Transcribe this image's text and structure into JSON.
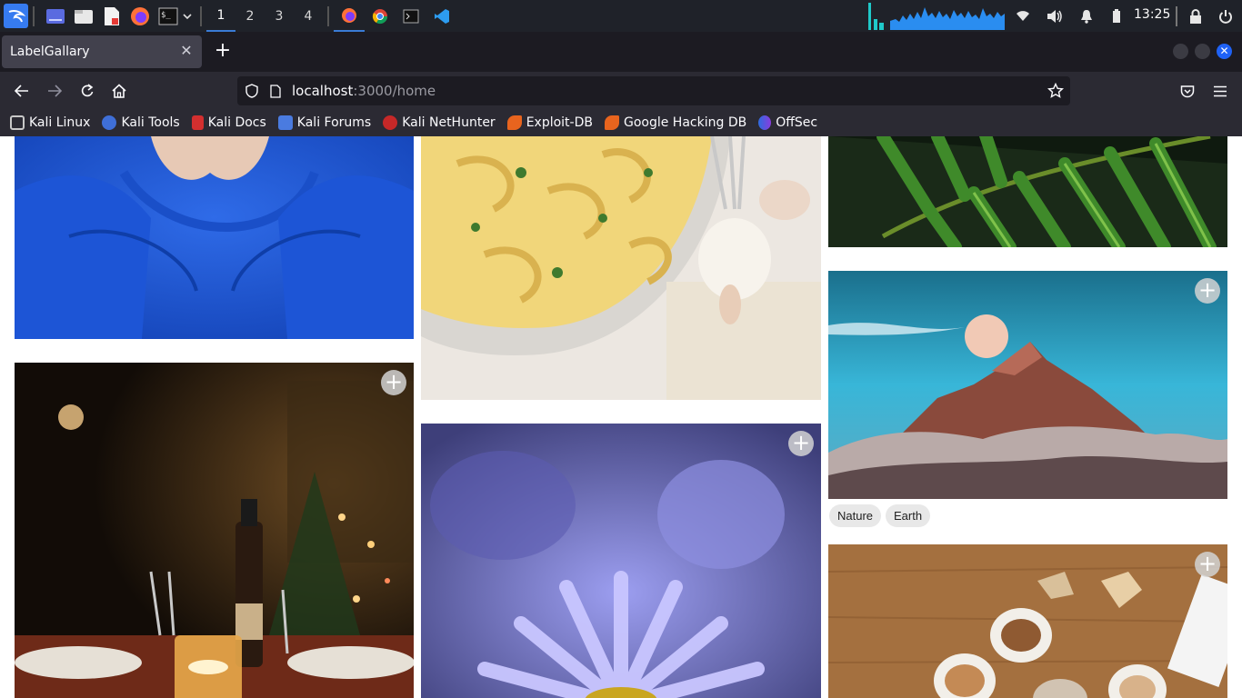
{
  "taskbar": {
    "workspaces": [
      "1",
      "2",
      "3",
      "4"
    ],
    "active_workspace": "1",
    "clock": "13:25",
    "icons": [
      "kali-menu-icon",
      "workspace-desktop-icon",
      "file-manager-icon",
      "text-editor-icon",
      "firefox-icon",
      "terminal-icon",
      "chevron-down-icon",
      "firefox-window-icon",
      "chrome-window-icon",
      "terminal-window-icon",
      "vscode-window-icon",
      "network-icon",
      "volume-icon",
      "notification-bell-icon",
      "battery-icon",
      "lock-icon",
      "power-icon"
    ]
  },
  "browser": {
    "tab_title": "LabelGallary",
    "url_host": "localhost",
    "url_rest": ":3000/home",
    "bookmarks": [
      "Kali Linux",
      "Kali Tools",
      "Kali Docs",
      "Kali Forums",
      "Kali NetHunter",
      "Exploit-DB",
      "Google Hacking DB",
      "OffSec"
    ]
  },
  "gallery": {
    "add_label": "+",
    "items": [
      {
        "name": "blue-sweatshirt-photo",
        "tags": []
      },
      {
        "name": "pasta-photo",
        "tags": []
      },
      {
        "name": "palm-leaf-photo",
        "tags": []
      },
      {
        "name": "dinner-table-photo",
        "tags": []
      },
      {
        "name": "purple-flower-photo",
        "tags": []
      },
      {
        "name": "mountain-moon-photo",
        "tags": [
          "Nature",
          "Earth"
        ]
      },
      {
        "name": "coffee-table-photo",
        "tags": []
      }
    ]
  },
  "colors": {
    "taskbar_bg": "#1f2229",
    "chrome_bg": "#2b2a33",
    "accent": "#3a7bd5"
  }
}
